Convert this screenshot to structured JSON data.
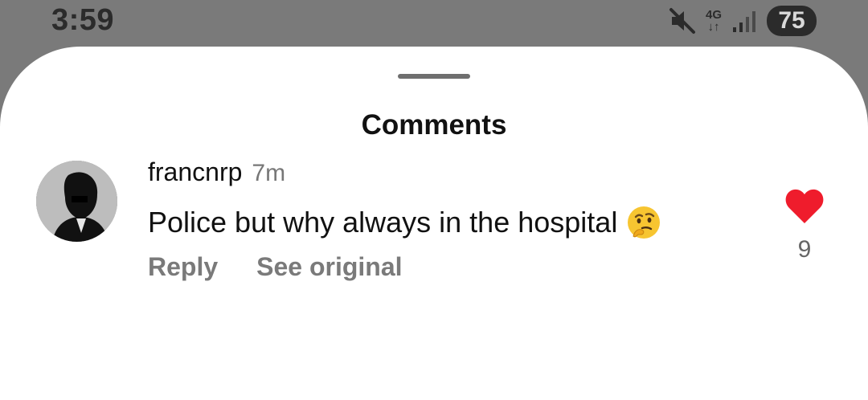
{
  "status_bar": {
    "time": "3:59",
    "network_label": "4G",
    "network_arrows": "↓↑",
    "battery": "75",
    "icons": [
      "mute-icon",
      "network-4g-icon",
      "signal-icon",
      "battery-icon"
    ]
  },
  "sheet": {
    "title": "Comments"
  },
  "comment": {
    "username": "francnrp",
    "time": "7m",
    "text": "Police but why always in the hospital",
    "emoji": "thinking-face-icon",
    "reply_label": "Reply",
    "see_original_label": "See original",
    "like_count": "9",
    "liked": true
  },
  "colors": {
    "heart": "#ef1c2c",
    "overlay": "#7a7a7a"
  }
}
